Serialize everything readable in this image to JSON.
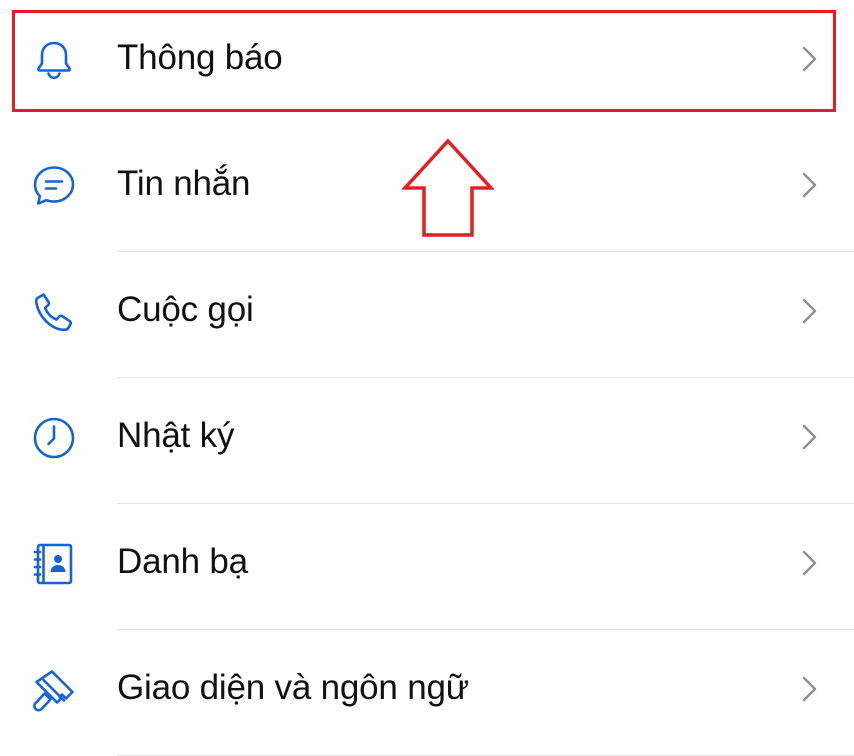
{
  "theme": {
    "icon_color": "#1463d8",
    "text_color": "#111111",
    "chevron_color": "#8e8e93",
    "divider_color": "#e5e5e8",
    "annotation_color": "#e31e24"
  },
  "settings": {
    "items": [
      {
        "label": "Thông báo",
        "icon": "bell-icon"
      },
      {
        "label": "Tin nhắn",
        "icon": "chat-bubble-icon"
      },
      {
        "label": "Cuộc gọi",
        "icon": "phone-icon"
      },
      {
        "label": "Nhật ký",
        "icon": "clock-icon"
      },
      {
        "label": "Danh bạ",
        "icon": "contacts-book-icon"
      },
      {
        "label": "Giao diện và ngôn ngữ",
        "icon": "paintbrush-icon"
      }
    ]
  },
  "annotations": {
    "highlighted_item": "Thông báo",
    "arrow_direction": "up"
  }
}
